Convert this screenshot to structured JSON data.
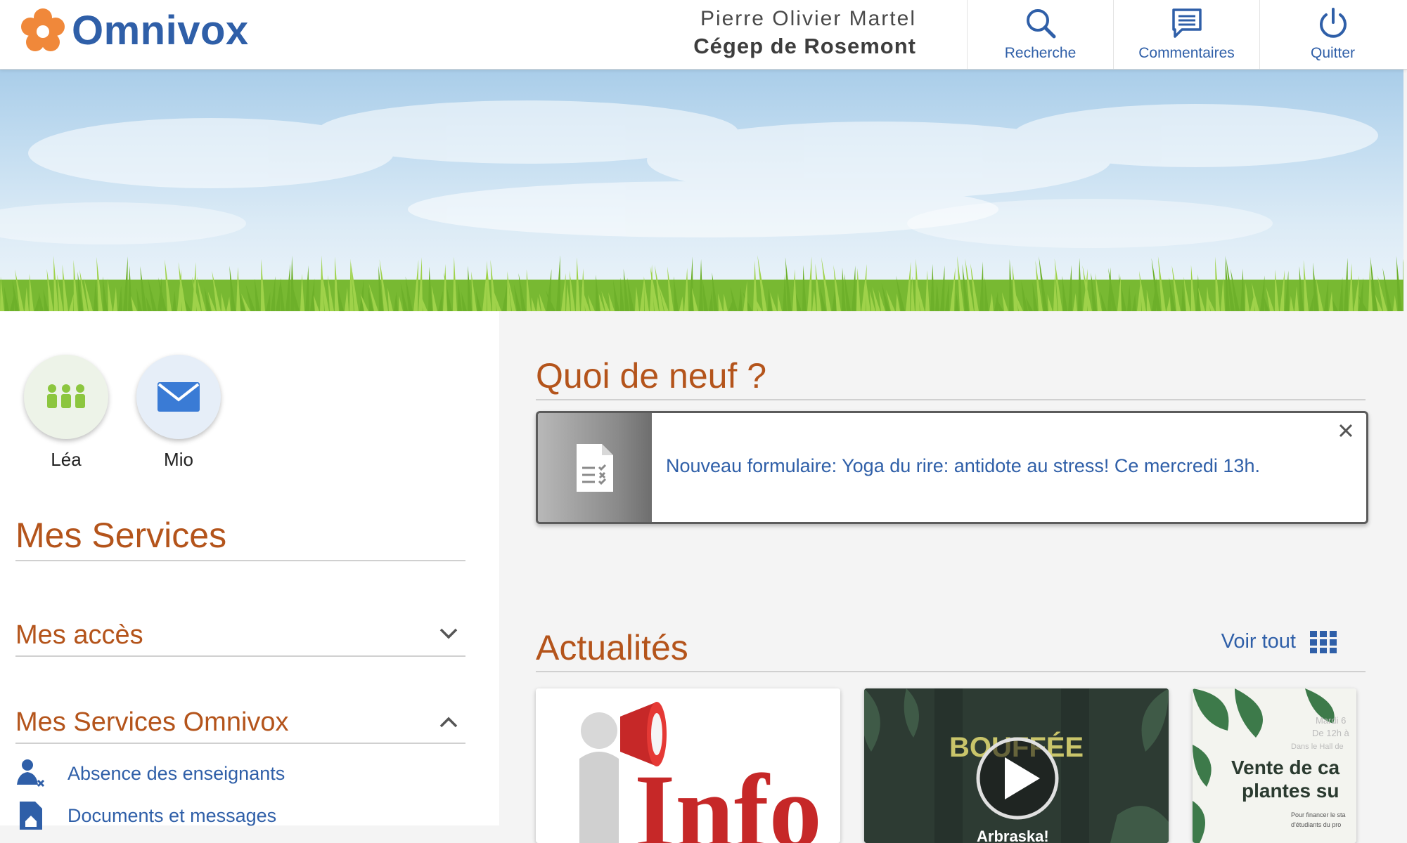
{
  "header": {
    "logo_text": "Omnivox",
    "user_name": "Pierre Olivier Martel",
    "school": "Cégep de Rosemont",
    "buttons": [
      {
        "label": "Recherche",
        "icon": "search-icon"
      },
      {
        "label": "Commentaires",
        "icon": "comment-icon"
      },
      {
        "label": "Quitter",
        "icon": "power-icon"
      }
    ]
  },
  "quick_access": [
    {
      "label": "Léa",
      "icon": "people-icon",
      "color": "#8cc63f"
    },
    {
      "label": "Mio",
      "icon": "mail-icon",
      "color": "#3a7bd5"
    }
  ],
  "left": {
    "mes_services": "Mes Services",
    "mes_acces": "Mes accès",
    "mes_services_omnivox": "Mes Services Omnivox",
    "items": [
      {
        "label": "Absence des enseignants",
        "icon": "teacher-absent-icon"
      },
      {
        "label": "Documents et messages",
        "icon": "document-icon"
      }
    ]
  },
  "right": {
    "quoi_de_neuf": "Quoi de neuf ?",
    "notification": "Nouveau formulaire: Yoga du rire: antidote au stress! Ce mercredi 13h.",
    "actualites": "Actualités",
    "voir_tout": "Voir tout",
    "cards": [
      {
        "caption": "Info"
      },
      {
        "caption": "BOUFFÉE",
        "sub": "Arbraska!"
      },
      {
        "caption_line1": "Vente de ca",
        "caption_line2": "plantes su",
        "meta1": "Mardi 6",
        "meta2": "De 12h à",
        "meta3": "Dans le Hall de",
        "foot1": "Pour financer le sta",
        "foot2": "d'étudiants du pro"
      }
    ]
  },
  "colors": {
    "brand_blue": "#2f5fa8",
    "accent_orange": "#b4541b",
    "logo_orange": "#f0883a"
  }
}
